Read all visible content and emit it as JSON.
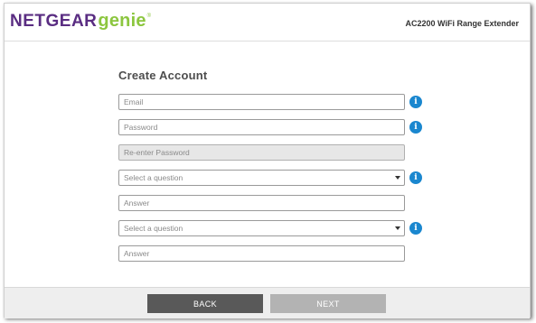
{
  "header": {
    "logo_brand": "NETGEAR",
    "logo_product": "genie",
    "product_name": "AC2200 WiFi Range Extender"
  },
  "form": {
    "title": "Create Account",
    "email": {
      "placeholder": "Email",
      "value": ""
    },
    "password": {
      "placeholder": "Password",
      "value": ""
    },
    "reenter_password": {
      "placeholder": "Re-enter Password",
      "value": "",
      "disabled": true
    },
    "question1": {
      "selected": "Select a question"
    },
    "answer1": {
      "placeholder": "Answer",
      "value": ""
    },
    "question2": {
      "selected": "Select a question"
    },
    "answer2": {
      "placeholder": "Answer",
      "value": ""
    },
    "info_icon": "i"
  },
  "footer": {
    "back_label": "BACK",
    "next_label": "NEXT"
  },
  "colors": {
    "brand_purple": "#5a2d82",
    "brand_green": "#8cc63f",
    "info_blue": "#1a87cf",
    "back_button": "#595959",
    "next_button_disabled": "#b3b3b3"
  },
  "icons": [
    "info-icon",
    "chevron-down-icon"
  ]
}
